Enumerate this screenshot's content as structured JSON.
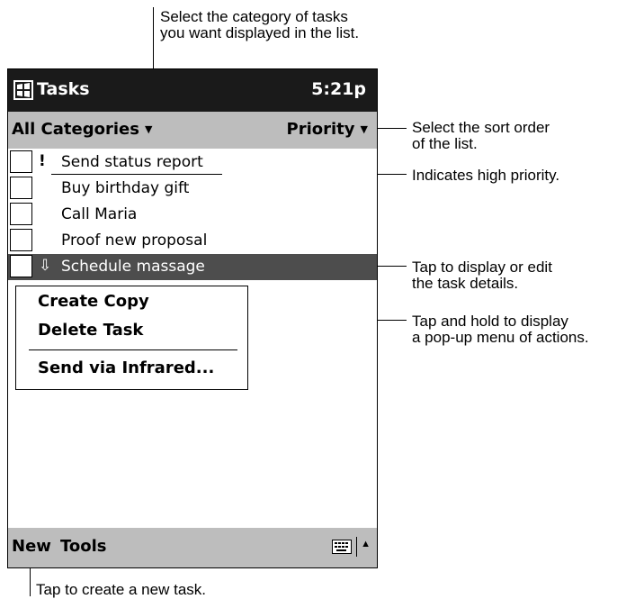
{
  "callouts": {
    "category": "Select the category of tasks\nyou want displayed in the list.",
    "sort": "Select the sort order\nof the list.",
    "priority": "Indicates high priority.",
    "tap": "Tap to display or edit\nthe task details.",
    "hold": "Tap and hold to display\na pop-up menu of actions.",
    "new": "Tap to create a new  task."
  },
  "app": {
    "title": "Tasks",
    "clock": "5:21p",
    "start_icon": "windows-flag-icon"
  },
  "filter": {
    "category": "All Categories",
    "sort": "Priority"
  },
  "tasks": [
    {
      "name": "Send status report",
      "priority": "!",
      "checked": false
    },
    {
      "name": "Buy birthday gift",
      "priority": "",
      "checked": false
    },
    {
      "name": "Call Maria",
      "priority": "",
      "checked": false
    },
    {
      "name": "Proof new proposal",
      "priority": "",
      "checked": false
    },
    {
      "name": "Schedule massage",
      "priority": "⇩",
      "checked": false,
      "selected": true
    }
  ],
  "context_menu": {
    "items": [
      "Create Copy",
      "Delete Task",
      "Send via Infrared..."
    ]
  },
  "command_bar": {
    "new_label": "New",
    "tools_label": "Tools",
    "sip_icon": "keyboard-icon"
  }
}
